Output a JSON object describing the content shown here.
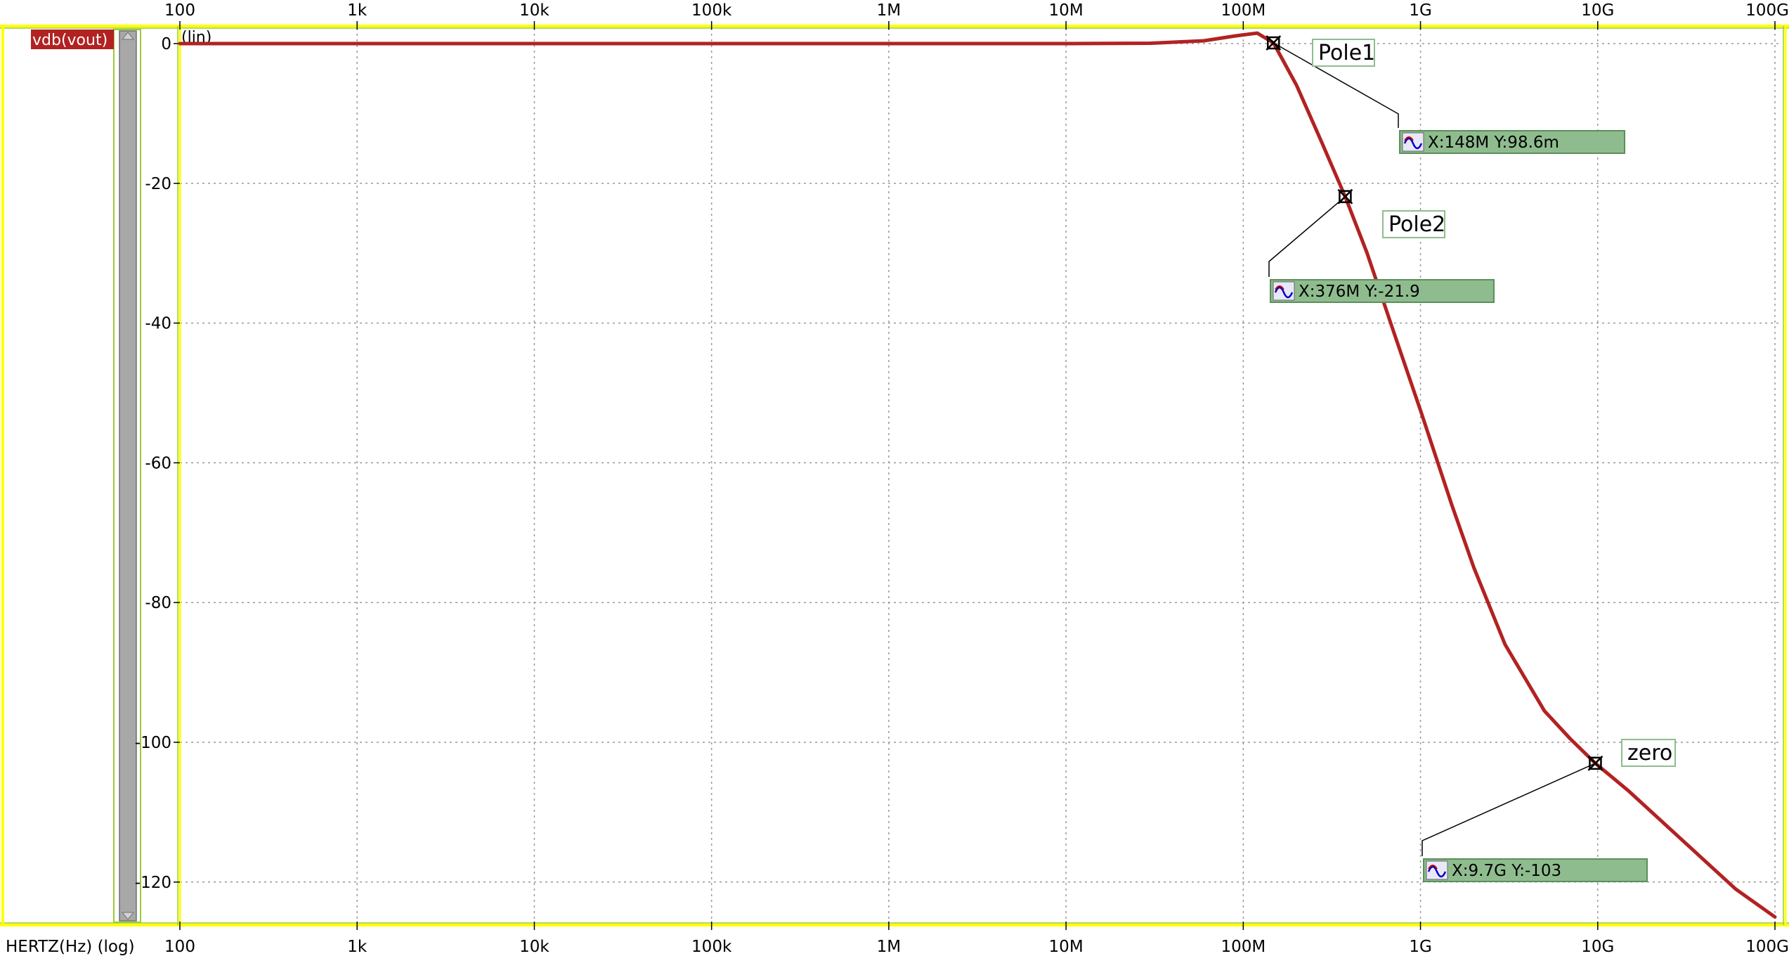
{
  "signal": {
    "name": "vdb(vout)",
    "color": "#b22222"
  },
  "y_scale_label": "(lin)",
  "x_axis_label": "HERTZ(Hz) (log)",
  "x_tick_labels": [
    "100",
    "1k",
    "10k",
    "100k",
    "1M",
    "10M",
    "100M",
    "1G",
    "10G",
    "100G"
  ],
  "y_tick_labels": [
    "0",
    "-20",
    "-40",
    "-60",
    "-80",
    "-100",
    "-120"
  ],
  "markers": [
    {
      "name": "Pole1",
      "readout": "X:148M Y:98.6m"
    },
    {
      "name": "Pole2",
      "readout": "X:376M Y:-21.9"
    },
    {
      "name": "zero",
      "readout": "X:9.7G Y:-103"
    }
  ],
  "colors": {
    "trace": "#b22222",
    "frame": "#ffff00",
    "scrollbar": "#a8a8a8",
    "readout_fill": "#8fbc8f",
    "grid": "#999999"
  },
  "chart_data": {
    "type": "line",
    "x_scale": "log",
    "xlim": [
      100,
      100000000000
    ],
    "ylim": [
      -125,
      0.5
    ],
    "grid": true,
    "series": [
      {
        "name": "vdb(vout)",
        "x": [
          100,
          1000,
          10000,
          100000,
          1000000,
          10000000,
          30000000,
          60000000,
          90000000,
          120000000,
          148000000,
          200000000,
          276000000,
          376000000,
          500000000,
          700000000,
          1000000000,
          1500000000,
          2000000000,
          3000000000,
          5000000000,
          7000000000,
          9700000000,
          15000000000,
          30000000000,
          60000000000,
          100000000000
        ],
        "y": [
          0,
          0,
          0,
          0,
          0,
          0,
          0.05,
          0.4,
          1.1,
          1.5,
          0.0986,
          -6,
          -14,
          -21.9,
          -30,
          -41,
          -52.5,
          -66,
          -75,
          -86,
          -95.5,
          -99.5,
          -103,
          -107,
          -114,
          -121,
          -125
        ]
      }
    ],
    "markers": [
      {
        "label": "Pole1",
        "x": 148000000,
        "y": 0.0986
      },
      {
        "label": "Pole2",
        "x": 376000000,
        "y": -21.9
      },
      {
        "label": "zero",
        "x": 9700000000,
        "y": -103
      }
    ]
  }
}
